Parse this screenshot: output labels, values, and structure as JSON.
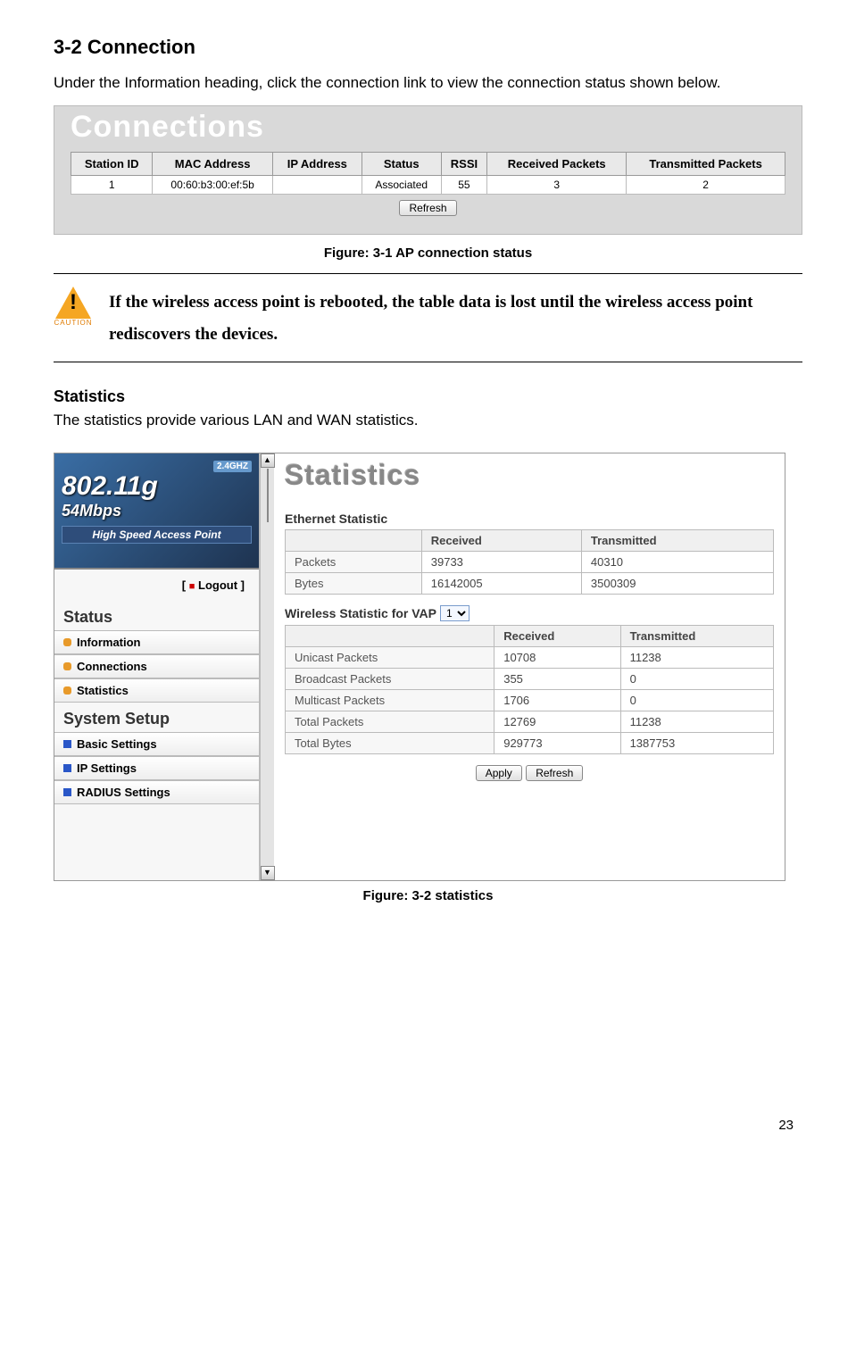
{
  "section": {
    "heading": "3-2  Connection",
    "intro": "Under the Information heading, click the connection link to view the connection status shown below."
  },
  "connections": {
    "title": "Connections",
    "headers": [
      "Station ID",
      "MAC Address",
      "IP Address",
      "Status",
      "RSSI",
      "Received Packets",
      "Transmitted Packets"
    ],
    "row": {
      "station_id": "1",
      "mac": "00:60:b3:00:ef:5b",
      "ip": "",
      "status": "Associated",
      "rssi": "55",
      "rx": "3",
      "tx": "2"
    },
    "refresh": "Refresh"
  },
  "fig1_caption": "Figure: 3-1 AP connection status",
  "caution": {
    "label": "CAUTION",
    "text": "If the wireless access point is rebooted, the table data is lost until the wireless access point rediscovers the devices."
  },
  "statistics": {
    "heading": "Statistics",
    "intro": "The statistics provide various LAN and WAN statistics."
  },
  "stats_ui": {
    "banner": {
      "ghz": "2.4GHZ",
      "proto": "802.11g",
      "rate": "54Mbps",
      "sub": "High Speed Access Point"
    },
    "logout": "Logout",
    "sidebar": {
      "status_heading": "Status",
      "status_items": [
        "Information",
        "Connections",
        "Statistics"
      ],
      "setup_heading": "System Setup",
      "setup_items": [
        "Basic Settings",
        "IP Settings",
        "RADIUS Settings"
      ]
    },
    "main_title": "Statistics",
    "eth": {
      "title": "Ethernet Statistic",
      "cols": [
        "",
        "Received",
        "Transmitted"
      ],
      "rows": [
        {
          "label": "Packets",
          "rx": "39733",
          "tx": "40310"
        },
        {
          "label": "Bytes",
          "rx": "16142005",
          "tx": "3500309"
        }
      ]
    },
    "wlan": {
      "title": "Wireless Statistic for VAP",
      "vap_selected": "1",
      "cols": [
        "",
        "Received",
        "Transmitted"
      ],
      "rows": [
        {
          "label": "Unicast Packets",
          "rx": "10708",
          "tx": "11238"
        },
        {
          "label": "Broadcast Packets",
          "rx": "355",
          "tx": "0"
        },
        {
          "label": "Multicast Packets",
          "rx": "1706",
          "tx": "0"
        },
        {
          "label": "Total Packets",
          "rx": "12769",
          "tx": "11238"
        },
        {
          "label": "Total Bytes",
          "rx": "929773",
          "tx": "1387753"
        }
      ]
    },
    "buttons": {
      "apply": "Apply",
      "refresh": "Refresh"
    }
  },
  "fig2_caption": "Figure: 3-2 statistics",
  "page_num": "23"
}
